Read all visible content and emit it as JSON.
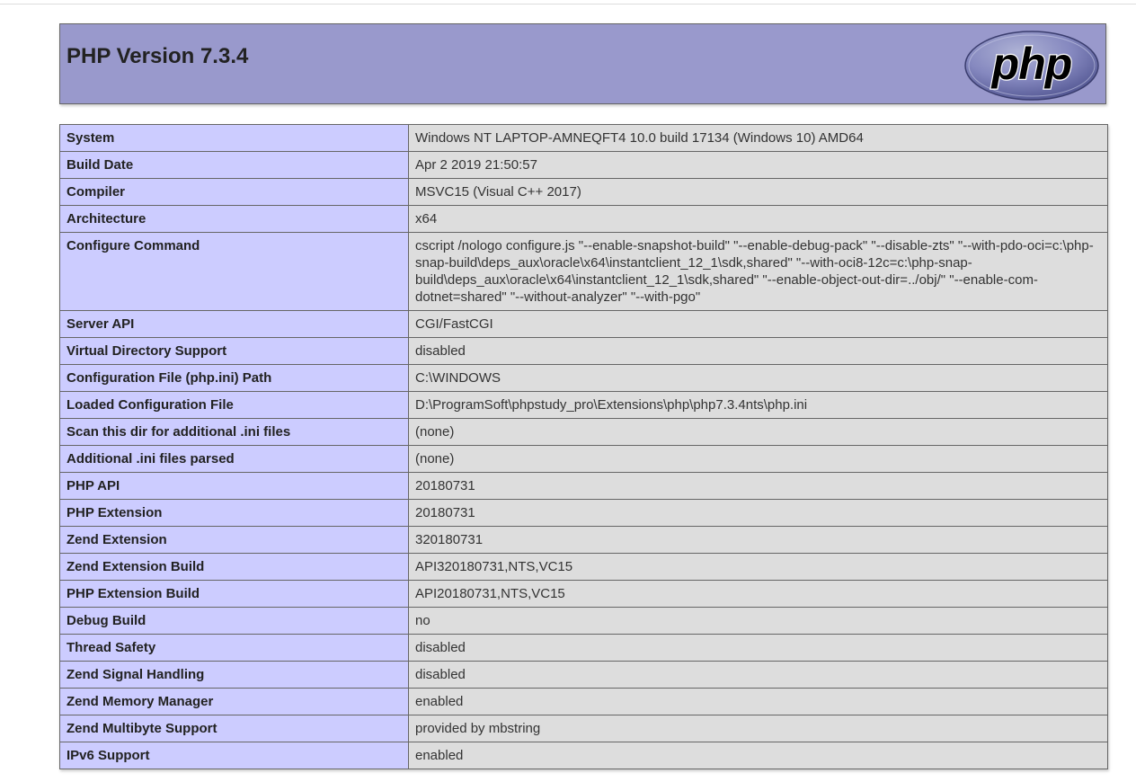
{
  "page": {
    "title": "PHP Version 7.3.4",
    "logo_text": "php"
  },
  "rows": [
    {
      "label": "System",
      "value": "Windows NT LAPTOP-AMNEQFT4 10.0 build 17134 (Windows 10) AMD64"
    },
    {
      "label": "Build Date",
      "value": "Apr 2 2019 21:50:57"
    },
    {
      "label": "Compiler",
      "value": "MSVC15 (Visual C++ 2017)"
    },
    {
      "label": "Architecture",
      "value": "x64"
    },
    {
      "label": "Configure Command",
      "value": "cscript /nologo configure.js \"--enable-snapshot-build\" \"--enable-debug-pack\" \"--disable-zts\" \"--with-pdo-oci=c:\\php-snap-build\\deps_aux\\oracle\\x64\\instantclient_12_1\\sdk,shared\" \"--with-oci8-12c=c:\\php-snap-build\\deps_aux\\oracle\\x64\\instantclient_12_1\\sdk,shared\" \"--enable-object-out-dir=../obj/\" \"--enable-com-dotnet=shared\" \"--without-analyzer\" \"--with-pgo\""
    },
    {
      "label": "Server API",
      "value": "CGI/FastCGI"
    },
    {
      "label": "Virtual Directory Support",
      "value": "disabled"
    },
    {
      "label": "Configuration File (php.ini) Path",
      "value": "C:\\WINDOWS"
    },
    {
      "label": "Loaded Configuration File",
      "value": "D:\\ProgramSoft\\phpstudy_pro\\Extensions\\php\\php7.3.4nts\\php.ini"
    },
    {
      "label": "Scan this dir for additional .ini files",
      "value": "(none)"
    },
    {
      "label": "Additional .ini files parsed",
      "value": "(none)"
    },
    {
      "label": "PHP API",
      "value": "20180731"
    },
    {
      "label": "PHP Extension",
      "value": "20180731"
    },
    {
      "label": "Zend Extension",
      "value": "320180731"
    },
    {
      "label": "Zend Extension Build",
      "value": "API320180731,NTS,VC15"
    },
    {
      "label": "PHP Extension Build",
      "value": "API20180731,NTS,VC15"
    },
    {
      "label": "Debug Build",
      "value": "no"
    },
    {
      "label": "Thread Safety",
      "value": "disabled"
    },
    {
      "label": "Zend Signal Handling",
      "value": "disabled"
    },
    {
      "label": "Zend Memory Manager",
      "value": "enabled"
    },
    {
      "label": "Zend Multibyte Support",
      "value": "provided by mbstring"
    },
    {
      "label": "IPv6 Support",
      "value": "enabled"
    }
  ]
}
